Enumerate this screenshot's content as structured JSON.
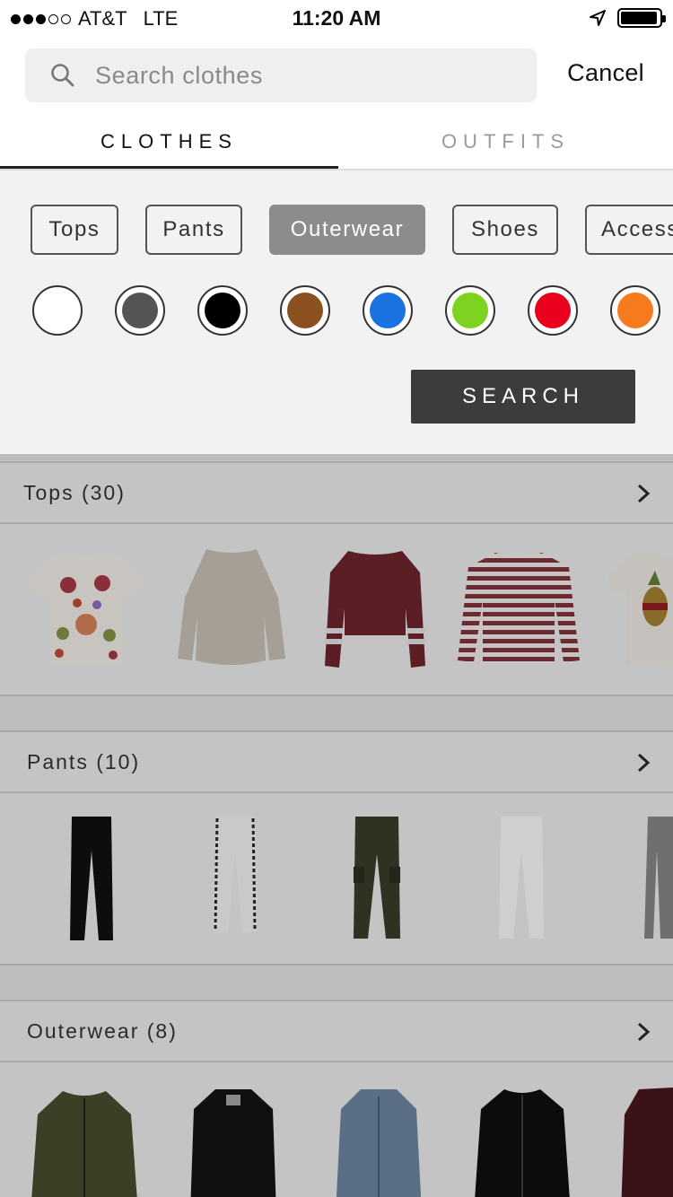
{
  "status_bar": {
    "carrier": "AT&T",
    "network": "LTE",
    "time": "11:20 AM",
    "signal_bars_filled": 3,
    "signal_bars_total": 5,
    "battery_level": 0.95
  },
  "search": {
    "placeholder": "Search clothes",
    "value": "",
    "cancel_label": "Cancel"
  },
  "tabs": [
    {
      "label": "CLOTHES",
      "active": true
    },
    {
      "label": "OUTFITS",
      "active": false
    }
  ],
  "filter": {
    "categories": [
      {
        "label": "Tops",
        "selected": false
      },
      {
        "label": "Pants",
        "selected": false
      },
      {
        "label": "Outerwear",
        "selected": true
      },
      {
        "label": "Shoes",
        "selected": false
      },
      {
        "label": "Accessories",
        "selected": false
      }
    ],
    "colors": [
      {
        "name": "white",
        "hex": "#ffffff"
      },
      {
        "name": "dark-gray",
        "hex": "#555555"
      },
      {
        "name": "black",
        "hex": "#000000"
      },
      {
        "name": "brown",
        "hex": "#8b5020"
      },
      {
        "name": "blue",
        "hex": "#1a73e0"
      },
      {
        "name": "green",
        "hex": "#7ed321"
      },
      {
        "name": "red",
        "hex": "#e8001c"
      },
      {
        "name": "orange",
        "hex": "#f87a1e"
      }
    ],
    "search_button": "SEARCH"
  },
  "sections": [
    {
      "title": "Tops (30)",
      "items": [
        "floral-print-tshirt",
        "knit-sweater",
        "burgundy-crop-sweatshirt",
        "striped-long-sleeve-top",
        "pineapple-print-tshirt"
      ]
    },
    {
      "title": "Pants (10)",
      "items": [
        "black-trousers",
        "white-track-pants",
        "olive-cargo-pants",
        "white-slim-pants",
        "gray-trousers"
      ]
    },
    {
      "title": "Outerwear (8)",
      "items": [
        "olive-bomber-jacket",
        "black-leather-jacket",
        "denim-jacket",
        "black-bomber-jacket",
        "burgundy-blazer"
      ]
    }
  ],
  "colors": {
    "accent_dark": "#3c3c3c",
    "chip_selected": "#8c8c8c",
    "panel_bg": "#f2f2f2"
  }
}
